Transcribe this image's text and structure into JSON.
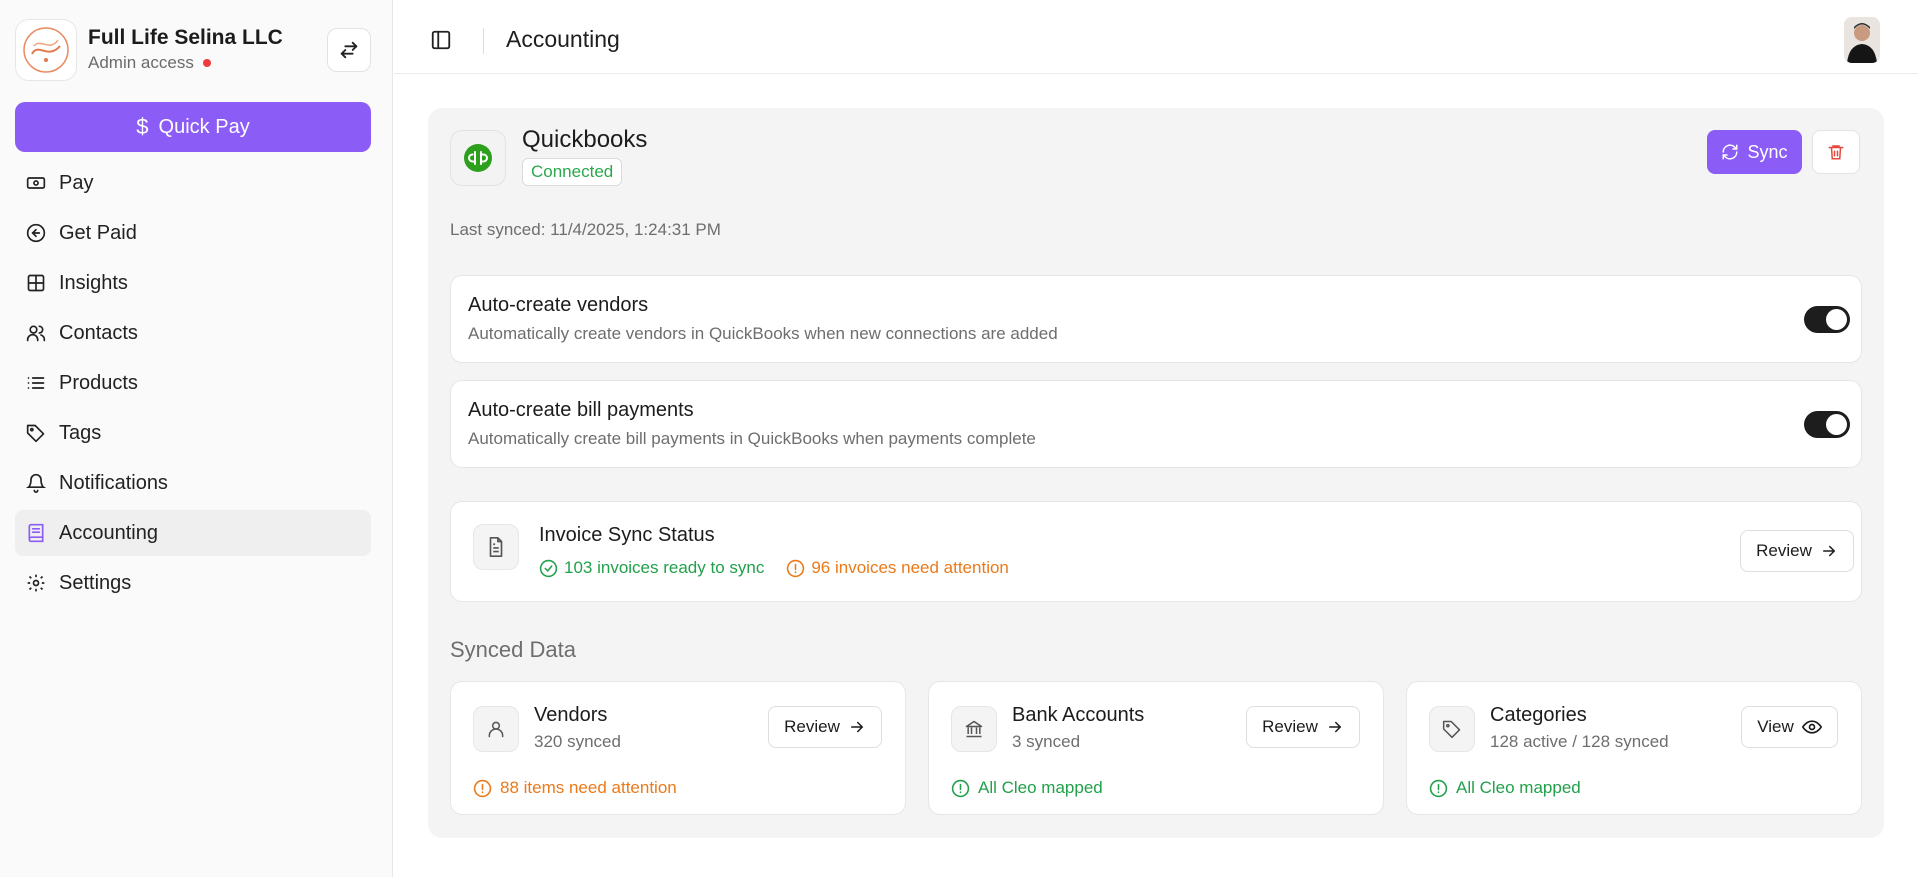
{
  "sidebar": {
    "org_name": "Full Life Selina LLC",
    "org_role": "Admin access",
    "quick_pay_label": "Quick Pay",
    "items": [
      {
        "label": "Pay",
        "icon": "cash-icon"
      },
      {
        "label": "Get Paid",
        "icon": "arrow-circle-left-icon"
      },
      {
        "label": "Insights",
        "icon": "grid-icon"
      },
      {
        "label": "Contacts",
        "icon": "users-icon"
      },
      {
        "label": "Products",
        "icon": "list-icon"
      },
      {
        "label": "Tags",
        "icon": "tag-icon"
      },
      {
        "label": "Notifications",
        "icon": "bell-icon"
      },
      {
        "label": "Accounting",
        "icon": "book-icon",
        "active": true
      },
      {
        "label": "Settings",
        "icon": "gear-icon"
      }
    ]
  },
  "header": {
    "title": "Accounting"
  },
  "integration": {
    "name": "Quickbooks",
    "status": "Connected",
    "sync_label": "Sync",
    "last_synced": "Last synced: 11/4/2025, 1:24:31 PM"
  },
  "settings": [
    {
      "title": "Auto-create vendors",
      "description": "Automatically create vendors in QuickBooks when new connections are added",
      "enabled": true
    },
    {
      "title": "Auto-create bill payments",
      "description": "Automatically create bill payments in QuickBooks when payments complete",
      "enabled": true
    }
  ],
  "invoice_sync": {
    "title": "Invoice Sync Status",
    "ready": "103 invoices ready to sync",
    "attention": "96 invoices need attention",
    "button_label": "Review"
  },
  "synced_data": {
    "heading": "Synced Data",
    "cards": [
      {
        "title": "Vendors",
        "subtitle": "320 synced",
        "button_label": "Review",
        "status": "88 items need attention",
        "status_type": "warning"
      },
      {
        "title": "Bank Accounts",
        "subtitle": "3 synced",
        "button_label": "Review",
        "status": "All Cleo mapped",
        "status_type": "ok"
      },
      {
        "title": "Categories",
        "subtitle": "128 active / 128 synced",
        "button_label": "View",
        "status": "All Cleo mapped",
        "status_type": "ok"
      }
    ]
  },
  "colors": {
    "accent": "#8b5cf6",
    "success": "#22a04a",
    "warning": "#ea7a1a",
    "danger": "#ef3b3b"
  }
}
